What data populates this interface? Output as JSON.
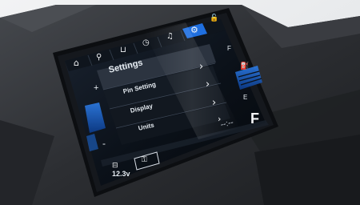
{
  "screen": {
    "title": "Settings",
    "menu": [
      {
        "label": "Pin Setting"
      },
      {
        "label": "Display"
      },
      {
        "label": "Units"
      }
    ],
    "tabs": [
      {
        "icon": "home-icon",
        "glyph": "⌂"
      },
      {
        "icon": "map-pin-icon",
        "glyph": "⚲"
      },
      {
        "icon": "vehicle-icon",
        "glyph": "⊔"
      },
      {
        "icon": "speedometer-icon",
        "glyph": "◷"
      },
      {
        "icon": "music-note-icon",
        "glyph": "♫"
      },
      {
        "icon": "gear-icon",
        "glyph": "⚙"
      },
      {
        "icon": "lock-open-icon",
        "glyph": "🔓"
      }
    ],
    "active_tab": "gear-icon",
    "fuel_full_marker": "F",
    "fuel_empty_marker": "E",
    "fuel_gauge_right_letter": "F",
    "left_plus": "+",
    "left_minus": "-",
    "battery_voltage": "12.3v",
    "footer_text": "--:--",
    "accent_color": "#1f6fe0",
    "bezel_color": "#2a2c30"
  }
}
